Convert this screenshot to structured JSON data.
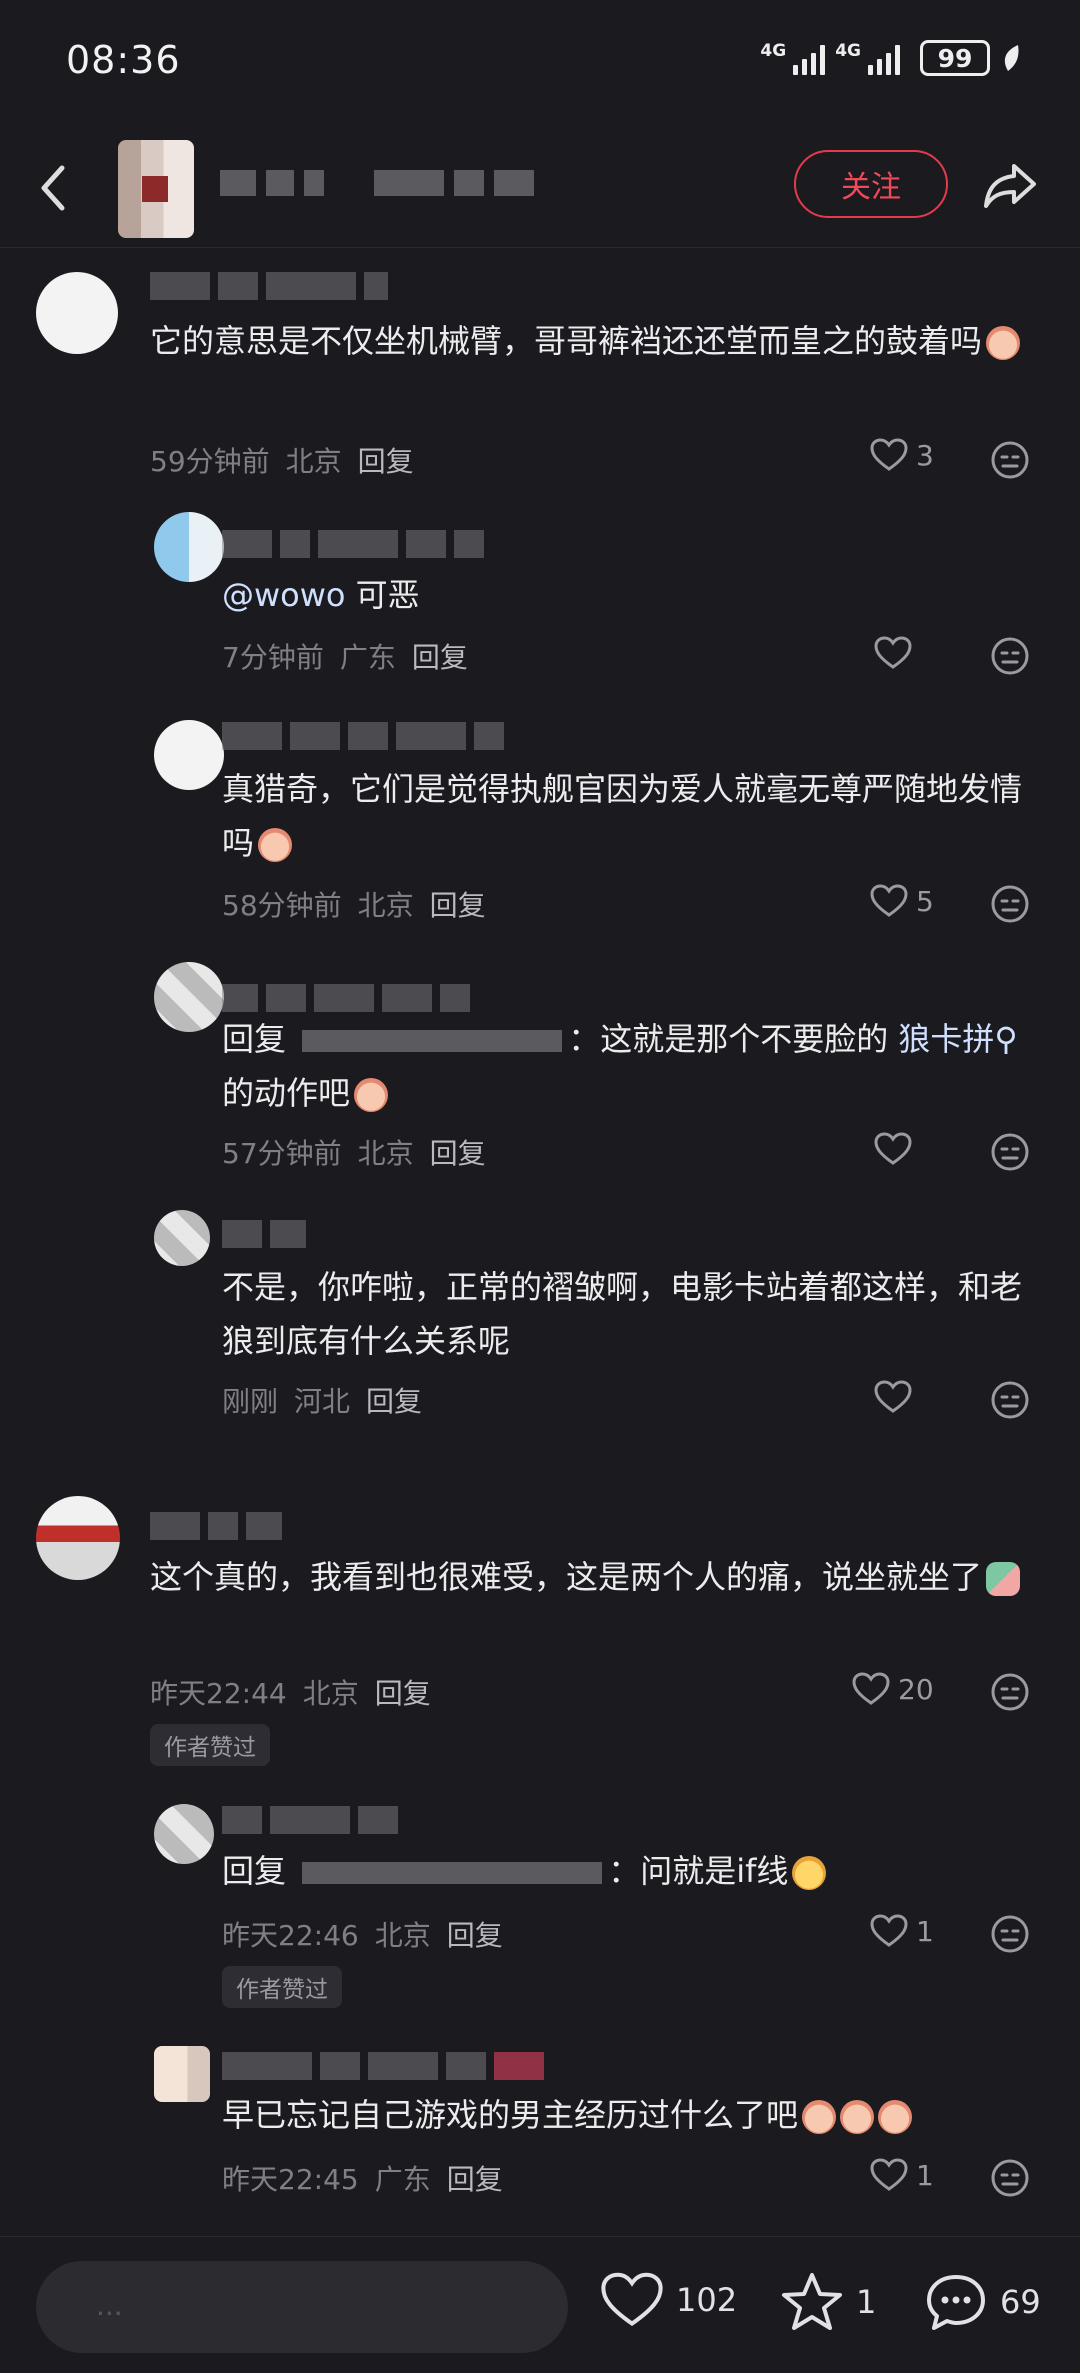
{
  "status_bar": {
    "time": "08:36",
    "network1": "4G",
    "network2": "4G",
    "battery": "99"
  },
  "header": {
    "follow_label": "关注"
  },
  "comments": [
    {
      "text": "它的意思是不仅坐机械臂，哥哥裤裆还还堂而皇之的鼓着吗",
      "time": "59分钟前",
      "location": "北京",
      "reply": "回复",
      "likes": "3"
    },
    {
      "mention": "@wowo",
      "text": "可恶",
      "time": "7分钟前",
      "location": "广东",
      "reply": "回复"
    },
    {
      "text": "真猎奇，它们是觉得执舰官因为爱人就毫无尊严随地发情吗",
      "time": "58分钟前",
      "location": "北京",
      "reply": "回复",
      "likes": "5"
    },
    {
      "prefix": "回复",
      "colon": "：",
      "text_a": "这就是那个不要脸的",
      "link": "狼卡拼",
      "text_b": "的动作吧",
      "time": "57分钟前",
      "location": "北京",
      "reply": "回复"
    },
    {
      "text": "不是，你咋啦，正常的褶皱啊，电影卡站着都这样，和老狼到底有什么关系呢",
      "time": "刚刚",
      "location": "河北",
      "reply": "回复"
    },
    {
      "text": "这个真的，我看到也很难受，这是两个人的痛，说坐就坐了",
      "time": "昨天22:44",
      "location": "北京",
      "reply": "回复",
      "likes": "20",
      "badge": "作者赞过"
    },
    {
      "prefix": "回复",
      "colon": "：",
      "text": "问就是if线",
      "time": "昨天22:46",
      "location": "北京",
      "reply": "回复",
      "likes": "1",
      "badge": "作者赞过"
    },
    {
      "text": "早已忘记自己游戏的男主经历过什么了吧",
      "time": "昨天22:45",
      "location": "广东",
      "reply": "回复",
      "likes": "1"
    }
  ],
  "bottom_bar": {
    "input_placeholder": "...",
    "likes": "102",
    "stars": "1",
    "comments": "69"
  },
  "colors": {
    "accent": "#e33b4b",
    "background": "#1b1b1f"
  }
}
